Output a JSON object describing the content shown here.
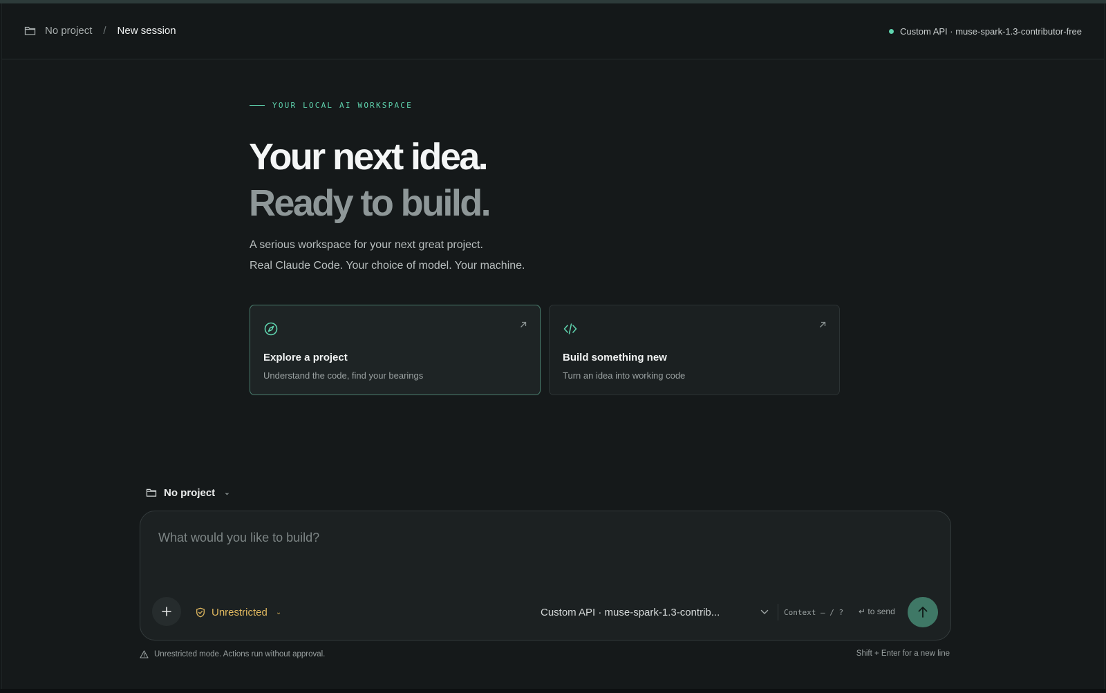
{
  "header": {
    "project": "No project",
    "separator": "/",
    "session": "New session",
    "status_text": "Custom API · muse-spark-1.3-contributor-free",
    "status_color": "#5fd3ae"
  },
  "hero": {
    "eyebrow": "YOUR LOCAL AI WORKSPACE",
    "headline_line1": "Your next idea.",
    "headline_line2": "Ready to build.",
    "subtitle_line1": "A serious workspace for your next great project.",
    "subtitle_line2": "Real Claude Code. Your choice of model. Your machine."
  },
  "cards": [
    {
      "title": "Explore a project",
      "description": "Understand the code, find your bearings",
      "icon": "compass-icon"
    },
    {
      "title": "Build something new",
      "description": "Turn an idea into working code",
      "icon": "code-icon"
    }
  ],
  "project_selector": {
    "label": "No project"
  },
  "composer": {
    "placeholder": "What would you like to build?",
    "mode_label": "Unrestricted",
    "model_label": "Custom API · muse-spark-1.3-contrib...",
    "context_label": "Context — / ?",
    "send_hint": "↵ to send"
  },
  "footer": {
    "warning": "Unrestricted mode. Actions run without approval.",
    "hint": "Shift + Enter for a new line"
  },
  "colors": {
    "accent": "#5fd3ae",
    "warning": "#e0b85f",
    "send_button": "#3f7866"
  }
}
